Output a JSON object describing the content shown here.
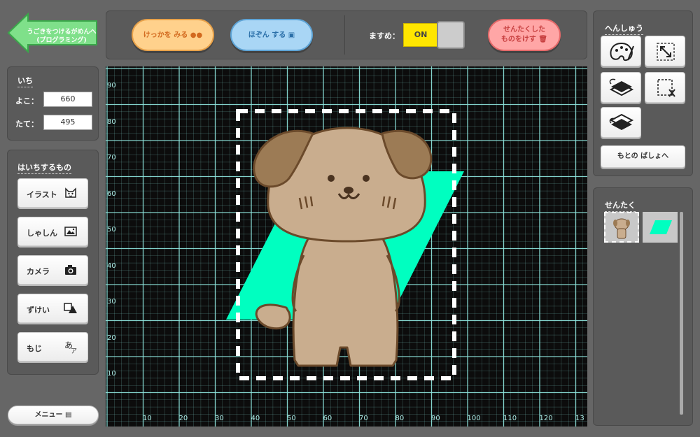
{
  "nav": {
    "back_label_line1": "うごきをつけるがめんへ",
    "back_label_line2": "(プログラミング)"
  },
  "position": {
    "title": "いち",
    "x_label": "よこ：",
    "x_value": "660",
    "y_label": "たて：",
    "y_value": "495"
  },
  "place": {
    "title": "はいちするもの",
    "items": [
      {
        "label": "イラスト",
        "icon": "cat-face-icon"
      },
      {
        "label": "しゃしん",
        "icon": "photo-icon"
      },
      {
        "label": "カメラ",
        "icon": "camera-icon"
      },
      {
        "label": "ずけい",
        "icon": "shapes-icon"
      },
      {
        "label": "もじ",
        "icon": "text-icon"
      }
    ]
  },
  "menu": {
    "label": "メニュー ▤"
  },
  "toolbar": {
    "check_label": "けっかを みる",
    "save_label": "ほぞん する",
    "grid_label": "ますめ：",
    "grid_toggle": "ON",
    "delete_label_line1": "せんたくした",
    "delete_label_line2": "ものをけす"
  },
  "canvas": {
    "y_ticks": [
      "90",
      "80",
      "70",
      "60",
      "50",
      "40",
      "30",
      "20",
      "10"
    ],
    "x_ticks": [
      "10",
      "20",
      "30",
      "40",
      "50",
      "60",
      "70",
      "80",
      "90",
      "100",
      "110",
      "120",
      "13"
    ],
    "grid_color": "#8fe8e0",
    "shape_color": "#00ffc0"
  },
  "edit": {
    "title": "へんしゅう",
    "buttons": [
      "palette-icon",
      "resize-icon",
      "bring-front-icon",
      "crop-icon",
      "send-back-icon"
    ],
    "reset_label": "もとの ばしょへ"
  },
  "selection": {
    "title": "せんたく",
    "items": [
      "dog-thumbnail",
      "parallelogram-thumbnail"
    ]
  }
}
